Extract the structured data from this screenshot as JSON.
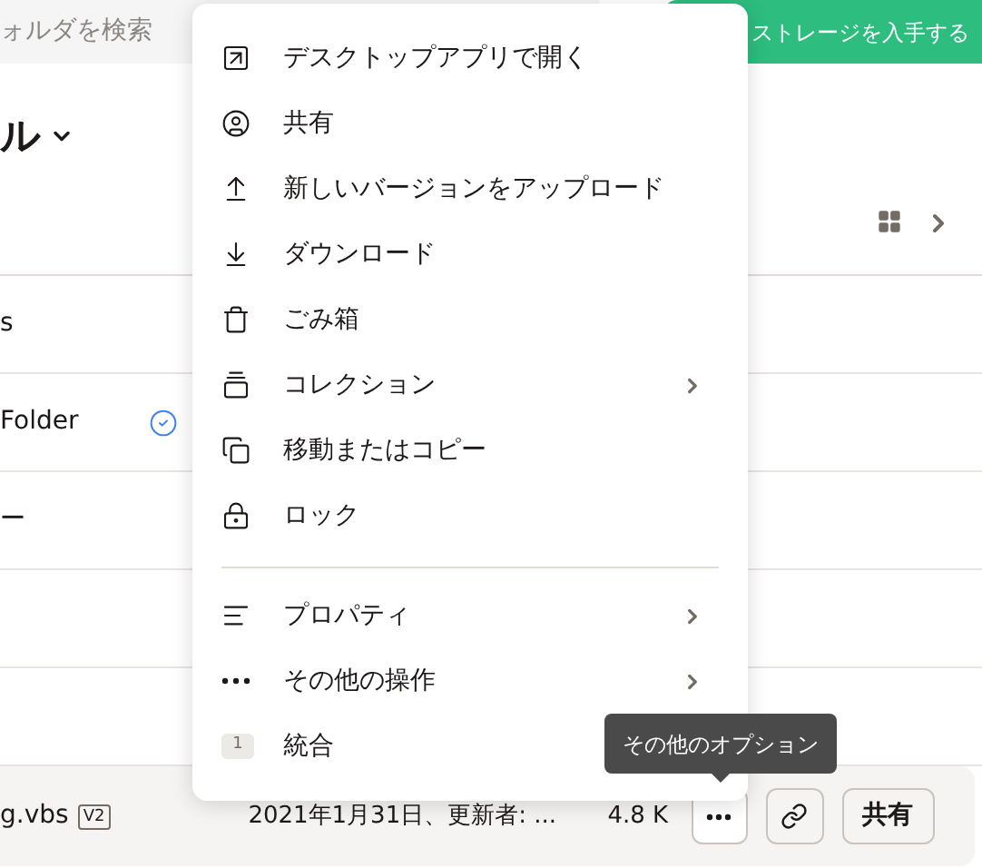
{
  "search": {
    "placeholder": "ォルダを検索"
  },
  "upgrade_button": "ストレージを入手する",
  "heading": "ル",
  "rows": [
    {
      "name": "s",
      "synced": false
    },
    {
      "name": "Folder",
      "synced": true
    },
    {
      "name": "ー",
      "synced": false
    },
    {
      "name": "",
      "synced": false
    },
    {
      "name": "",
      "synced": false
    }
  ],
  "selected_file": {
    "name": "g.vbs",
    "version": "V2",
    "modified": "2021年1月31日、更新者: ...",
    "size": "4.8 K",
    "share": "共有"
  },
  "menu": {
    "groups": [
      [
        {
          "label": "デスクトップアプリで開く",
          "submenu": false
        },
        {
          "label": "共有",
          "submenu": false
        },
        {
          "label": "新しいバージョンをアップロード",
          "submenu": false
        },
        {
          "label": "ダウンロード",
          "submenu": false
        },
        {
          "label": "ごみ箱",
          "submenu": false
        },
        {
          "label": "コレクション",
          "submenu": true
        },
        {
          "label": "移動またはコピー",
          "submenu": false
        },
        {
          "label": "ロック",
          "submenu": false
        }
      ],
      [
        {
          "label": "プロパティ",
          "submenu": true
        },
        {
          "label": "その他の操作",
          "submenu": true
        },
        {
          "label": "統合",
          "submenu": false,
          "badge": "1"
        }
      ]
    ]
  },
  "tooltip": "その他のオプション"
}
